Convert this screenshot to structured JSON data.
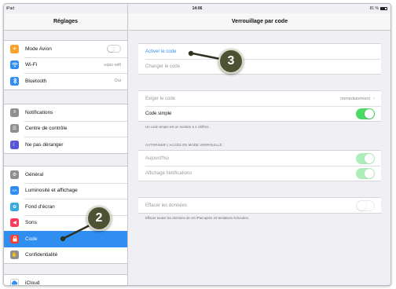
{
  "status_bar": {
    "device": "iPad",
    "time": "14:06",
    "battery": "81 %"
  },
  "sidebar": {
    "title": "Réglages",
    "groups": [
      {
        "items": [
          {
            "label": "Mode Avion",
            "icon": "airplane-icon",
            "icon_color": "#f7a22b",
            "control": "switch-off"
          },
          {
            "label": "Wi-Fi",
            "icon": "wifi-icon",
            "icon_color": "#2f8ef0",
            "value": "uqac-wifi"
          },
          {
            "label": "Bluetooth",
            "icon": "bluetooth-icon",
            "icon_color": "#2f8ef0",
            "value": "Oui"
          }
        ]
      },
      {
        "items": [
          {
            "label": "Notifications",
            "icon": "notifications-icon",
            "icon_color": "#8e8e93"
          },
          {
            "label": "Centre de contrôle",
            "icon": "control-center-icon",
            "icon_color": "#8e8e93"
          },
          {
            "label": "Ne pas déranger",
            "icon": "moon-icon",
            "icon_color": "#5856d6"
          }
        ]
      },
      {
        "items": [
          {
            "label": "Général",
            "icon": "gear-icon",
            "icon_color": "#8e8e93"
          },
          {
            "label": "Luminosité et affichage",
            "icon": "brightness-icon",
            "icon_color": "#2f8ef0"
          },
          {
            "label": "Fond d'écran",
            "icon": "wallpaper-icon",
            "icon_color": "#35aadc"
          },
          {
            "label": "Sons",
            "icon": "sound-icon",
            "icon_color": "#ff3b5c"
          },
          {
            "label": "Code",
            "icon": "lock-icon",
            "icon_color": "#ff3b30",
            "selected": true
          },
          {
            "label": "Confidentialité",
            "icon": "hand-icon",
            "icon_color": "#8e8e93"
          }
        ]
      },
      {
        "items": [
          {
            "label": "iCloud",
            "icon": "cloud-icon",
            "icon_color": "#ffffff"
          }
        ]
      }
    ]
  },
  "main": {
    "title": "Verrouillage par code",
    "code_group": {
      "activate": "Activer le code",
      "change": "Changer le code"
    },
    "require": {
      "label": "Exiger le code",
      "value": "Immédiatement"
    },
    "simple": {
      "label": "Code simple",
      "note": "Un code simple est un nombre à 4 chiffres."
    },
    "locked_section": {
      "title": "AUTORISER L'ACCÈS EN MODE VERROUILLÉ :",
      "today": "Aujourd'hui",
      "notifications": "Affichage Notifications"
    },
    "erase": {
      "label": "Effacer les données",
      "note": "Effacer toutes les données de cet iPad après 10 tentatives échouées."
    }
  },
  "callouts": {
    "step_sidebar": "2",
    "step_main": "3"
  },
  "colors": {
    "accent": "#2f8ef0",
    "switch_on": "#4cd964",
    "badge": "#4d5234"
  }
}
